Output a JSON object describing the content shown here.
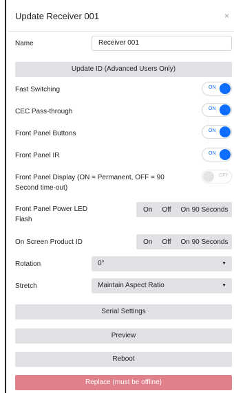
{
  "dialog": {
    "title": "Update Receiver 001",
    "close_glyph": "×"
  },
  "name_row": {
    "label": "Name",
    "value": "Receiver 001"
  },
  "update_id_label": "Update ID (Advanced Users Only)",
  "toggles": [
    {
      "label": "Fast Switching",
      "state": "ON"
    },
    {
      "label": "CEC Pass-through",
      "state": "ON"
    },
    {
      "label": "Front Panel Buttons",
      "state": "ON"
    },
    {
      "label": "Front Panel IR",
      "state": "ON"
    },
    {
      "label_line1": "Front Panel Display (ON = Permanent, OFF = 90",
      "label_line2": "Second time-out)",
      "state": "OFF"
    }
  ],
  "power_led": {
    "label_line1": "Front Panel Power LED",
    "label_line2": "Flash",
    "options": [
      "On",
      "Off",
      "On 90 Seconds"
    ]
  },
  "osd": {
    "label": "On Screen Product ID",
    "options": [
      "On",
      "Off",
      "On 90 Seconds"
    ]
  },
  "rotation": {
    "label": "Rotation",
    "value": "0°"
  },
  "stretch": {
    "label": "Stretch",
    "value": "Maintain Aspect Ratio"
  },
  "caret_glyph": "▼",
  "buttons": {
    "serial": "Serial Settings",
    "preview": "Preview",
    "reboot": "Reboot",
    "replace": "Replace (must be offline)"
  },
  "colors": {
    "accent": "#0d6efd",
    "button_bg": "#dfe1e5",
    "danger": "#e0808a"
  }
}
